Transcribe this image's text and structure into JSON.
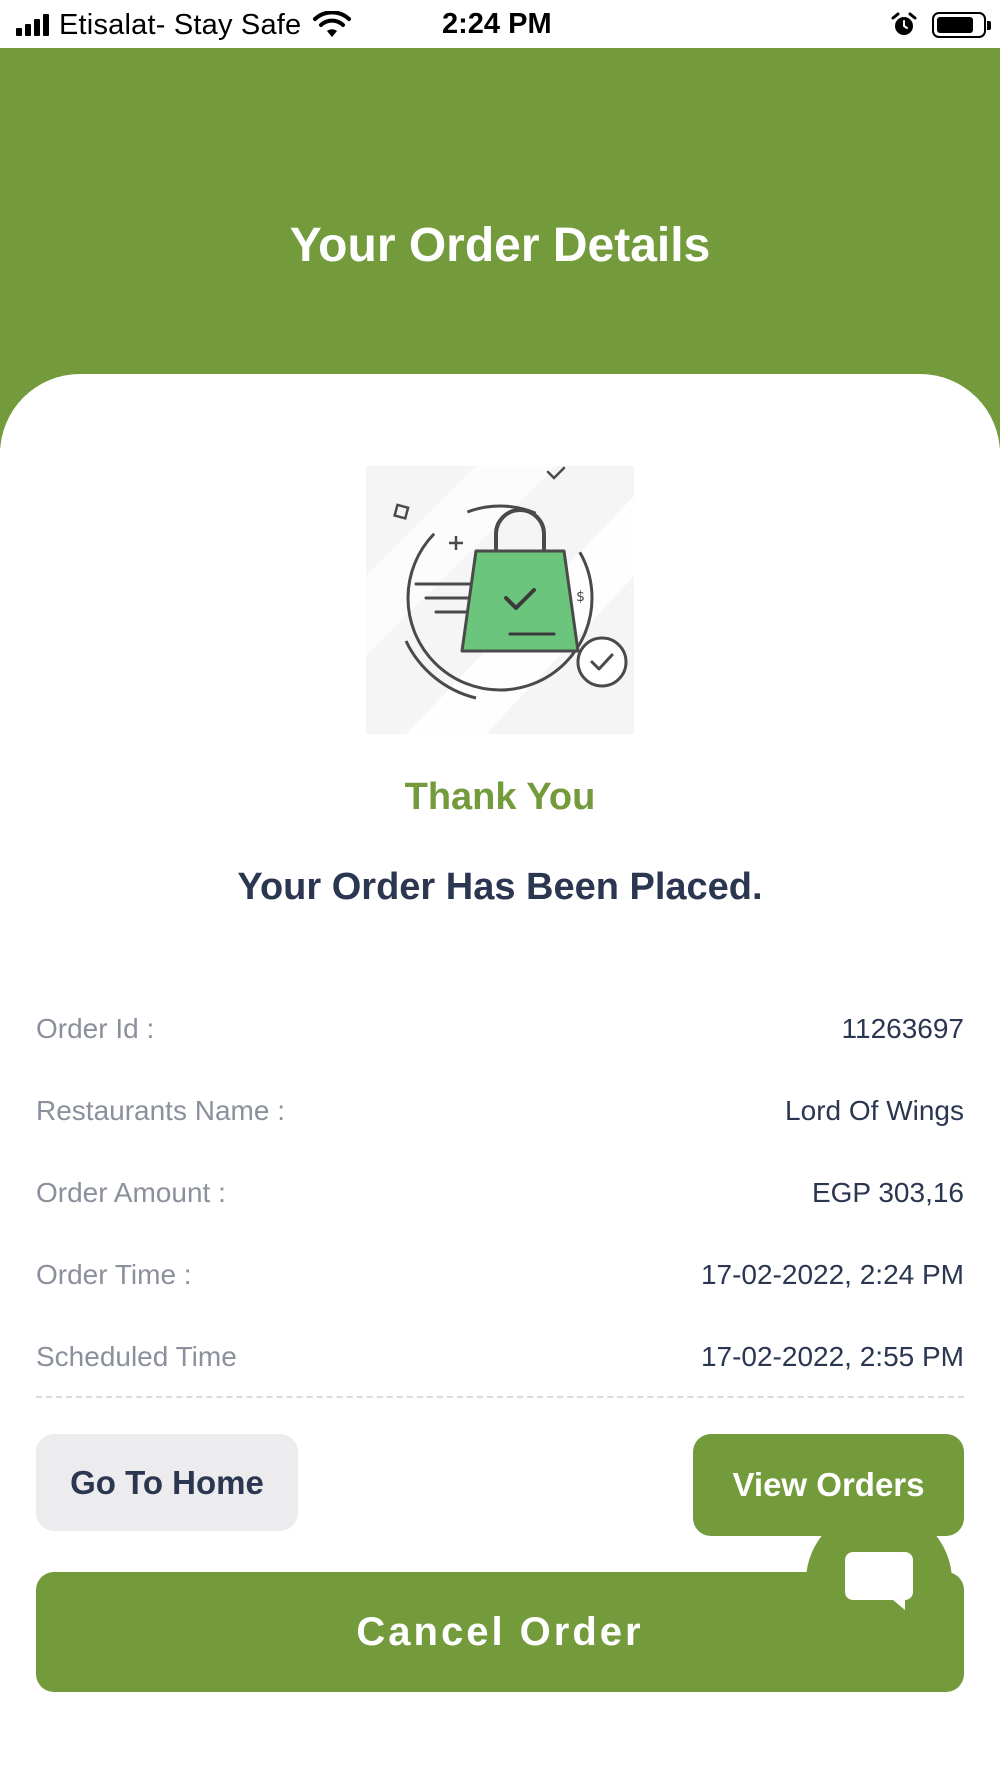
{
  "status_bar": {
    "carrier": "Etisalat- Stay Safe",
    "time": "2:24 PM",
    "icons": [
      "signal-icon",
      "wifi-icon",
      "alarm-icon",
      "battery-icon"
    ]
  },
  "header": {
    "title": "Your Order Details",
    "background_color": "#739a3b"
  },
  "illustration": {
    "icon": "shopping-bag-check-icon",
    "accent_color": "#6cc57c"
  },
  "confirmation": {
    "thanks": "Thank You",
    "message": "Your Order Has Been Placed."
  },
  "details": [
    {
      "label": "Order Id :",
      "value": "11263697"
    },
    {
      "label": "Restaurants Name :",
      "value": "Lord Of Wings"
    },
    {
      "label": "Order Amount :",
      "value": "EGP 303,16"
    },
    {
      "label": "Order Time :",
      "value": "17-02-2022, 2:24 PM"
    },
    {
      "label": "Scheduled Time",
      "value": "17-02-2022, 2:55 PM"
    }
  ],
  "actions": {
    "go_home": "Go To Home",
    "view_orders": "View Orders",
    "cancel_order": "Cancel Order"
  },
  "chat": {
    "icon": "chat-bubble-icon"
  },
  "colors": {
    "primary": "#739a3b",
    "text_dark": "#2b3650",
    "text_muted": "#8b909c",
    "secondary_button": "#ececee"
  }
}
